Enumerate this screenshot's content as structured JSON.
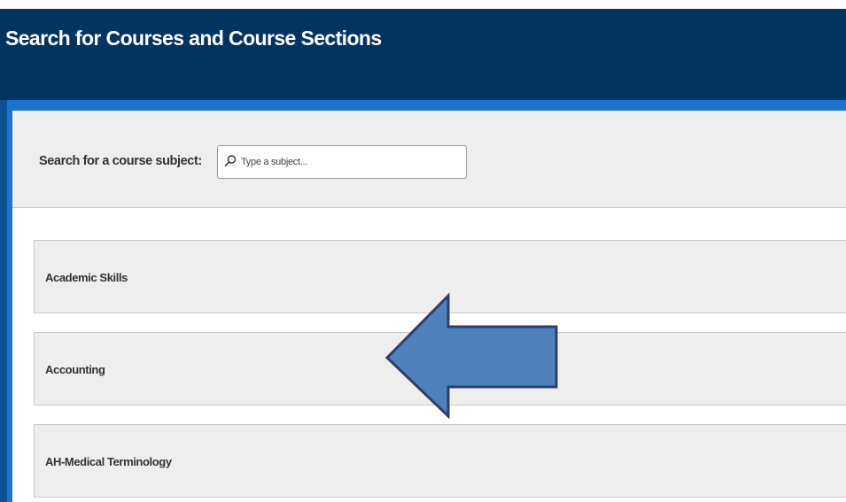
{
  "header": {
    "title": "Search for Courses and Course Sections"
  },
  "search": {
    "label": "Search for a course subject:",
    "placeholder": "Type a subject...",
    "value": ""
  },
  "subjects": [
    {
      "label": "Academic Skills"
    },
    {
      "label": "Accounting"
    },
    {
      "label": "AH-Medical Terminology"
    }
  ],
  "icons": {
    "search": "search-icon",
    "annotation": "left-arrow-annotation"
  },
  "colors": {
    "header_bg": "#03335f",
    "frame_accent": "#1b74cf",
    "panel_bg": "#eeeeee",
    "arrow_fill": "#4f81bd",
    "arrow_stroke": "#2f3d6b"
  }
}
